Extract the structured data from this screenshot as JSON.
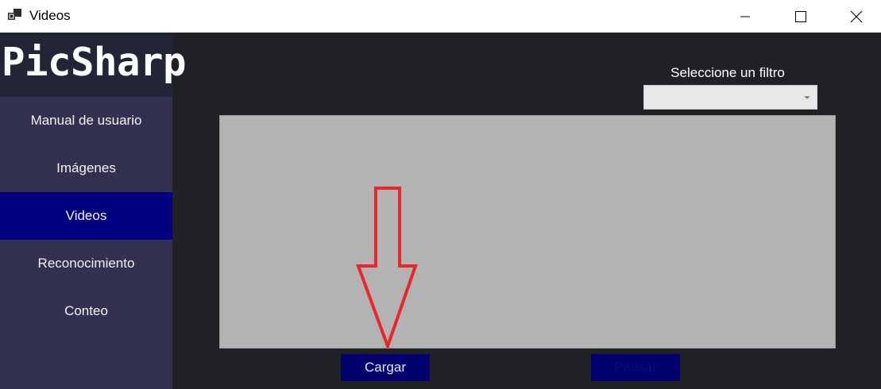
{
  "window": {
    "title": "Videos",
    "controls": {
      "minimize_icon": "minimize-icon",
      "maximize_icon": "maximize-icon",
      "close_icon": "close-icon"
    }
  },
  "sidebar": {
    "logo": "PicSharp",
    "items": [
      {
        "label": "Manual de usuario",
        "active": false
      },
      {
        "label": "Imágenes",
        "active": false
      },
      {
        "label": "Videos",
        "active": true
      },
      {
        "label": "Reconocimiento",
        "active": false
      },
      {
        "label": "Conteo",
        "active": false
      }
    ]
  },
  "main": {
    "filter": {
      "label": "Seleccione un filtro",
      "selected": ""
    },
    "buttons": {
      "load_label": "Cargar",
      "pause_label": "Pausar"
    }
  },
  "colors": {
    "sidebar_bg": "#32314f",
    "logo_bg": "#222536",
    "active_item": "#000080",
    "content_bg": "#202124",
    "panel_bg": "#b3b3b3",
    "button_bg": "#00006e",
    "annotation_arrow": "#e8262b"
  }
}
